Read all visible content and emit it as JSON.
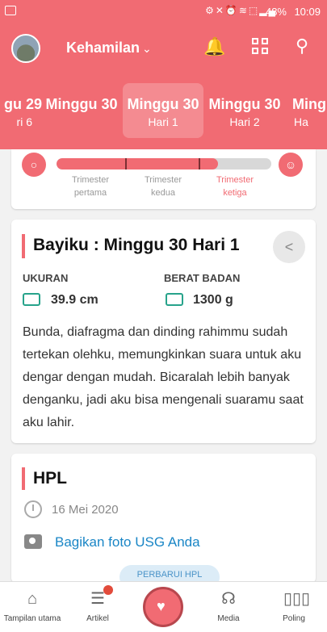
{
  "status_bar": {
    "battery": "48%",
    "time": "10:09",
    "icons": "⚙✕⏰≋⬚▂▄"
  },
  "header": {
    "title": "Kehamilan",
    "chevron_icon": "chevron-down-icon"
  },
  "weeks": [
    {
      "week": "gu 29",
      "day": "ri 6"
    },
    {
      "week": "Minggu 30",
      "day": ""
    },
    {
      "week": "Minggu 30",
      "day": "Hari 1",
      "active": true
    },
    {
      "week": "Minggu 30",
      "day": "Hari 2"
    },
    {
      "week": "Ming",
      "day": "Ha"
    }
  ],
  "trimester": {
    "progress": 0.75,
    "labels": [
      {
        "line1": "Trimester",
        "line2": "pertama"
      },
      {
        "line1": "Trimester",
        "line2": "kedua"
      },
      {
        "line1": "Trimester",
        "line2": "ketiga"
      }
    ]
  },
  "baby": {
    "title": "Bayiku : Minggu 30 Hari 1",
    "size_label": "UKURAN",
    "size_value": "39.9 cm",
    "weight_label": "BERAT BADAN",
    "weight_value": "1300 g",
    "description": "Bunda, diafragma dan dinding rahimmu sudah tertekan olehku, memungkinkan suara untuk aku dengar dengan mudah. Bicaralah lebih banyak denganku, jadi aku bisa mengenali suaramu saat aku lahir."
  },
  "hpl": {
    "title": "HPL",
    "date": "16 Mei 2020",
    "share_link": "Bagikan foto USG Anda",
    "peek_button": "PERBARUI HPL"
  },
  "bottom_nav": {
    "home": "Tampilan utama",
    "articles": "Artikel",
    "media": "Media",
    "poll": "Poling"
  },
  "colors": {
    "primary": "#f16b73",
    "accent": "#27a38b",
    "link": "#1a86c6"
  }
}
